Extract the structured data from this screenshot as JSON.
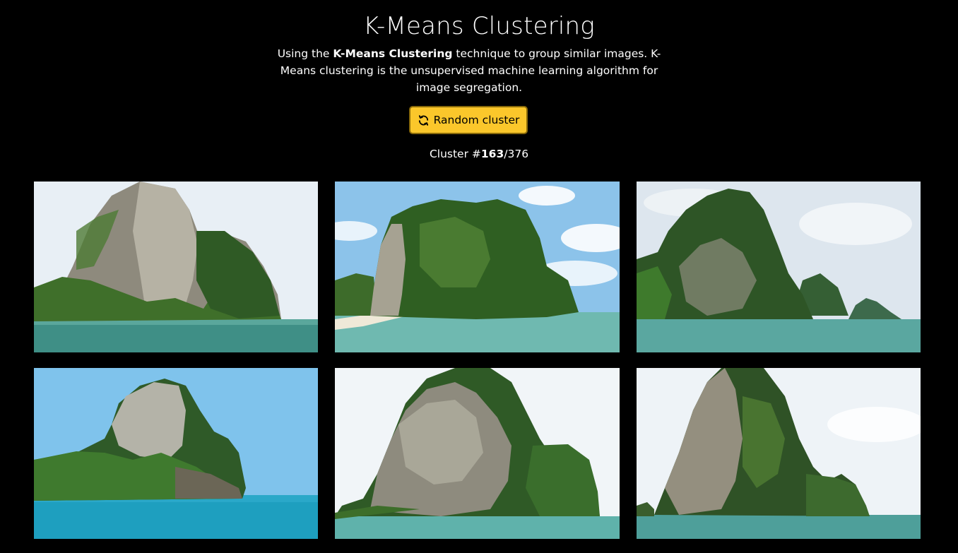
{
  "page": {
    "title": "K-Means Clustering",
    "description": {
      "prefix": "Using the ",
      "bold": "K-Means Clustering",
      "suffix": " technique to group similar images. K-Means clustering is the unsupervised machine learning algorithm for image segregation."
    },
    "button": {
      "label": "Random cluster",
      "icon": "refresh-icon",
      "color": "#fbc72b"
    },
    "cluster": {
      "prefix": "Cluster #",
      "current": "163",
      "separator": "/",
      "total": "376"
    }
  },
  "images": [
    {
      "subject": "limestone-karst-island",
      "sky": "#e6eef4",
      "sea": "#3f8f86"
    },
    {
      "subject": "limestone-karst-island",
      "sky": "#8cc3ea",
      "sea": "#6fb9b0"
    },
    {
      "subject": "limestone-karst-island",
      "sky": "#dfe7ee",
      "sea": "#5aa7a0"
    },
    {
      "subject": "limestone-karst-island",
      "sky": "#7fc3ec",
      "sea": "#1e9fbf"
    },
    {
      "subject": "limestone-karst-island",
      "sky": "#f1f5f8",
      "sea": "#5fb2ab"
    },
    {
      "subject": "limestone-karst-island",
      "sky": "#eef3f7",
      "sea": "#4e9f9a"
    }
  ]
}
